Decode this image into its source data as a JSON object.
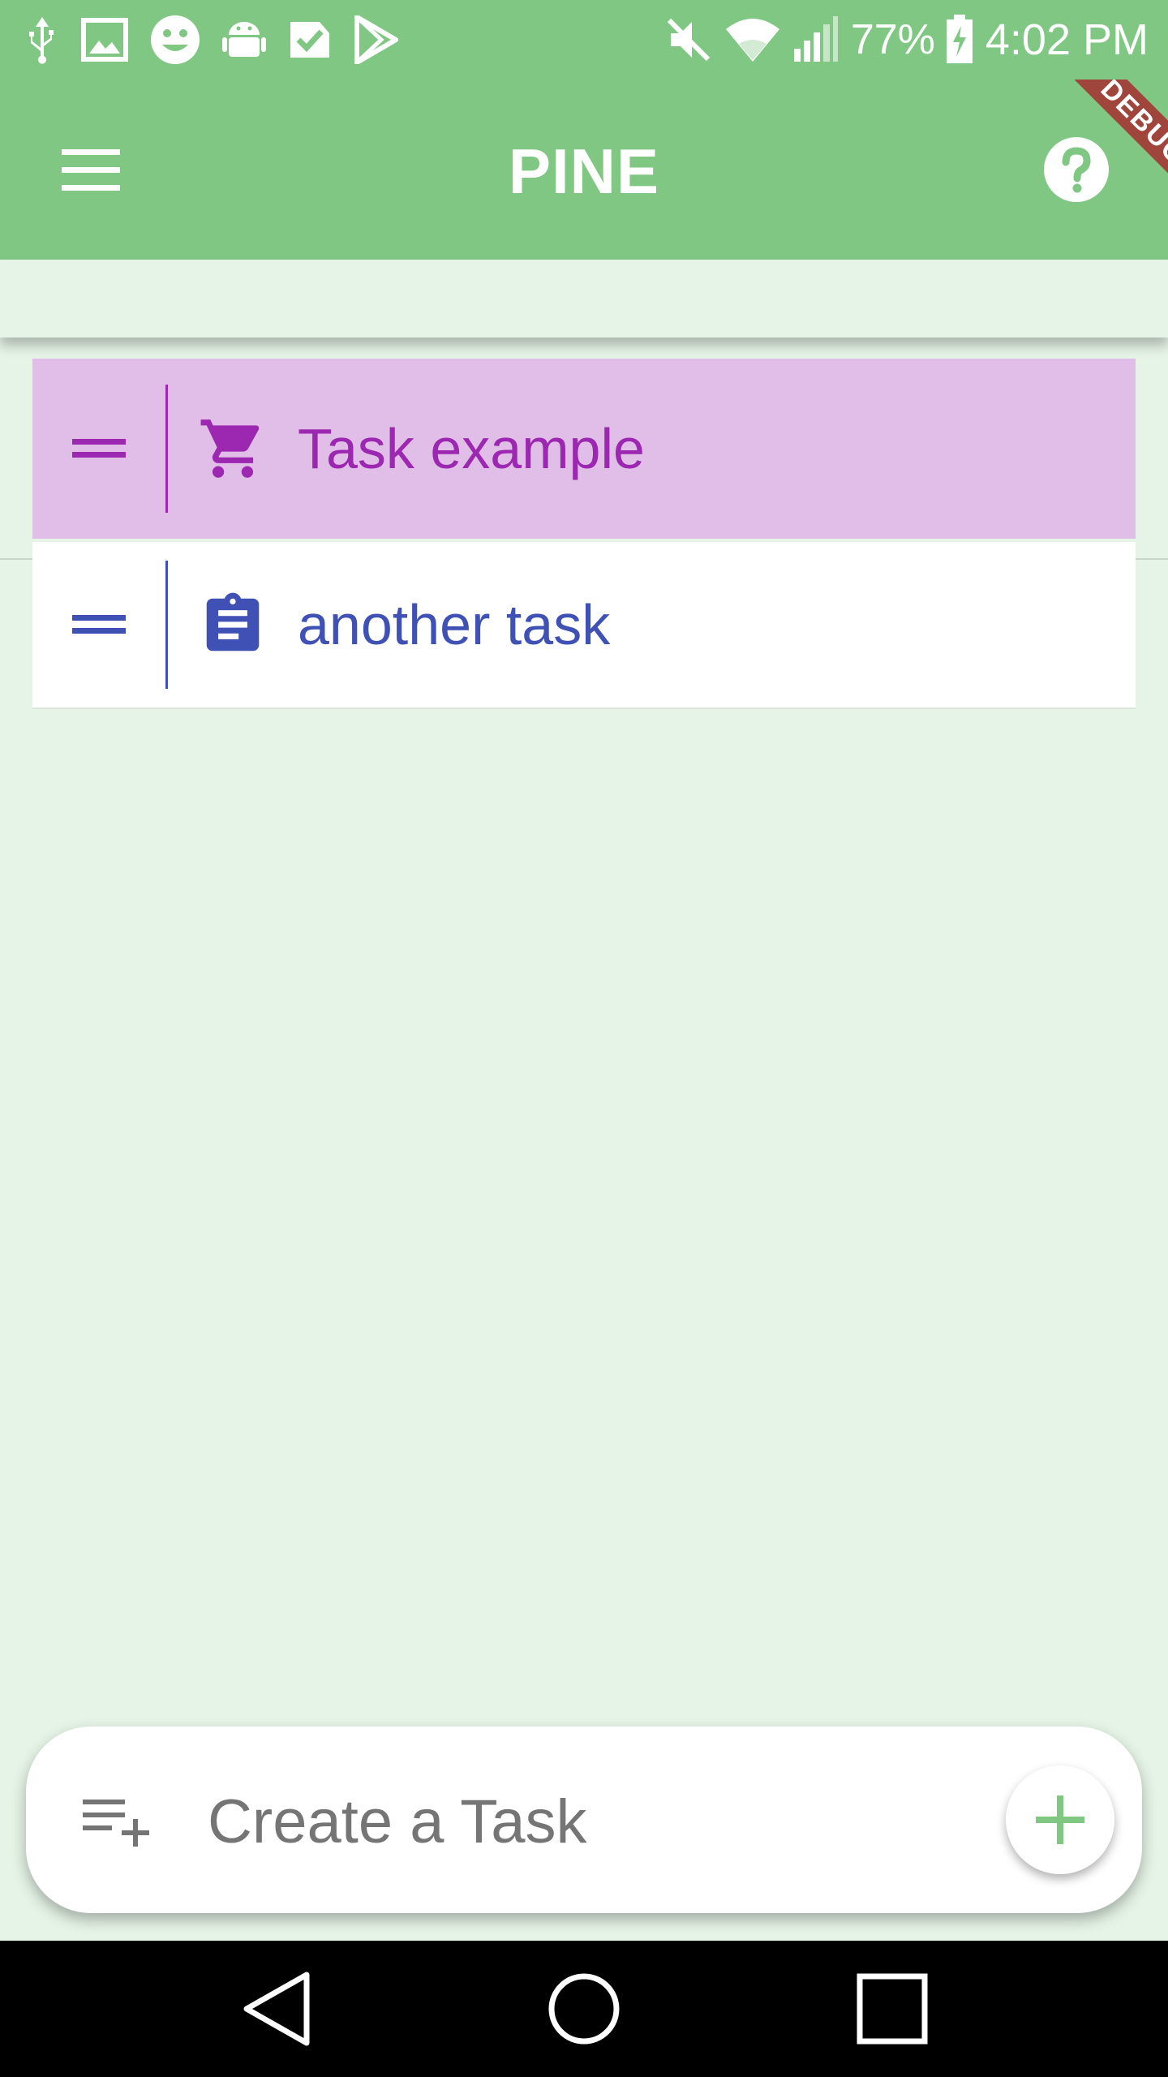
{
  "status_bar": {
    "battery": "77%",
    "time": "4:02 PM",
    "left_icons": [
      "usb-icon",
      "image-icon",
      "smiley-icon",
      "android-icon",
      "check-icon",
      "play-store-icon"
    ],
    "right_icons": [
      "mute-icon",
      "wifi-icon",
      "signal-icon",
      "battery-charging-icon"
    ]
  },
  "app_bar": {
    "title": "PINE",
    "menu_icon": "hamburger-menu-icon",
    "help_icon": "help-icon",
    "debug_banner": "DEBUG",
    "background": "#81c784"
  },
  "tasks": [
    {
      "label": "Task example",
      "icon": "shopping-cart-icon",
      "color": "#9c27b0",
      "background": "#e1bee7"
    },
    {
      "label": "another task",
      "icon": "clipboard-icon",
      "color": "#3f51b5",
      "background": "#ffffff"
    }
  ],
  "composer": {
    "placeholder": "Create a Task",
    "value": "",
    "add_icon": "plus-icon",
    "leading_icon": "playlist-add-icon",
    "accent": "#81c784"
  },
  "nav_bar": {
    "buttons": [
      "back-icon",
      "home-icon",
      "recents-icon"
    ]
  }
}
